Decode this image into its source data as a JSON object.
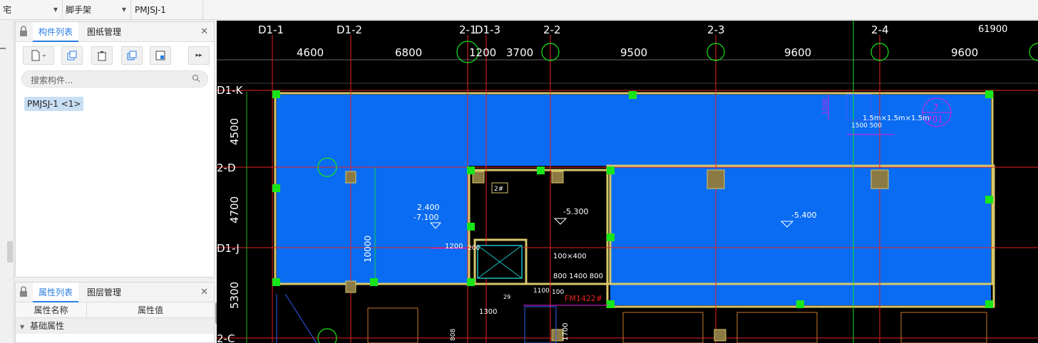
{
  "toolbar": {
    "dropdown_1": "宅",
    "dropdown_2": "脚手架",
    "dropdown_3": "PMJSJ-1"
  },
  "component_panel": {
    "tab_components": "构件列表",
    "tab_drawings": "图纸管理",
    "search_placeholder": "搜索构件...",
    "selected_item": "PMJSJ-1 <1>"
  },
  "property_panel": {
    "tab_properties": "属性列表",
    "tab_layers": "图层管理",
    "col_name": "属性名称",
    "col_value": "属性值",
    "group_basic": "基础属性"
  },
  "cad": {
    "axis_top": [
      "D1-1",
      "D1-2",
      "2-1",
      "D1-3",
      "2-2",
      "2-3",
      "2-4"
    ],
    "dims_top": [
      "4600",
      "6800",
      "1200",
      "3700",
      "9500",
      "9600",
      "9600"
    ],
    "total_dim": "61900",
    "axis_left": [
      "D1-K",
      "2-D",
      "D1-J",
      "2-C"
    ],
    "dims_left": [
      "4500",
      "4700",
      "5300"
    ],
    "elev_1": "2.400",
    "elev_2": "-7.100",
    "elev_3": "-5.300",
    "elev_4": "-5.400",
    "dim_10000": "10000",
    "dim_1200": "1200",
    "dim_200": "200",
    "dim_1500": "1500",
    "dim_1500_500": "1500 500",
    "size_label": "1.5m×1.5m×1.5m",
    "circle_top": "7",
    "circle_bottom": "701",
    "room_2": "2#",
    "opening": "100×400",
    "dims_door": "800 1400 800",
    "dim_1100": "1100",
    "dim_100": "100",
    "door_fm": "FM1422#",
    "dim_1300": "1300",
    "dim_1700": "1700",
    "dim_808": "808",
    "dim_29": "29"
  },
  "colors": {
    "accent": "#2a7de1",
    "floor_fill": "#0a6cf2",
    "grid_red": "#e8211f",
    "node_green": "#19e619",
    "wall_yellow": "#d8c86a"
  }
}
